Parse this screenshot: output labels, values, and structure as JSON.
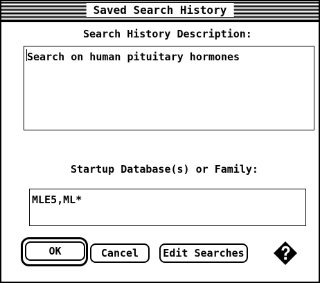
{
  "window": {
    "title": "Saved Search History"
  },
  "description": {
    "label": "Search History Description:",
    "value": "Search on human pituitary hormones"
  },
  "startup": {
    "label": "Startup Database(s) or Family:",
    "value": "MLE5,ML*"
  },
  "buttons": {
    "ok": "OK",
    "cancel": "Cancel",
    "edit_searches": "Edit Searches"
  },
  "icons": {
    "help": "help-diamond-icon"
  }
}
